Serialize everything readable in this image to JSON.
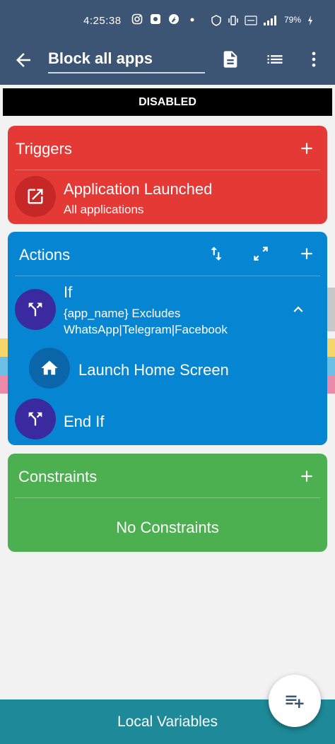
{
  "status_bar": {
    "time": "4:25:38",
    "battery": "79%",
    "icons": [
      "instagram-icon",
      "settings-icon",
      "app-icon",
      "dot-icon",
      "vpn-icon",
      "vibrate-icon",
      "volte-icon",
      "signal-icon",
      "battery-icon"
    ]
  },
  "appbar": {
    "title": "Block all apps",
    "actions": [
      "document-icon",
      "list-icon",
      "more-vert-icon"
    ]
  },
  "state_banner": "DISABLED",
  "triggers": {
    "title": "Triggers",
    "items": [
      {
        "title": "Application Launched",
        "subtitle": "All applications",
        "icon": "open-in-new-icon"
      }
    ]
  },
  "actions": {
    "title": "Actions",
    "if_block": {
      "title": "If",
      "condition": "{app_name} Excludes WhatsApp|Telegram|Facebook"
    },
    "nested_item": {
      "title": "Launch Home Screen",
      "icon": "home-icon"
    },
    "end_block": {
      "title": "End If"
    }
  },
  "constraints": {
    "title": "Constraints",
    "empty_text": "No Constraints"
  },
  "bottom_bar": {
    "label": "Local Variables"
  },
  "colors": {
    "header": "#3c5574",
    "triggers": "#e53935",
    "actions": "#0685d2",
    "constraints": "#4caf50",
    "bottom_bar": "#1e8a99"
  }
}
